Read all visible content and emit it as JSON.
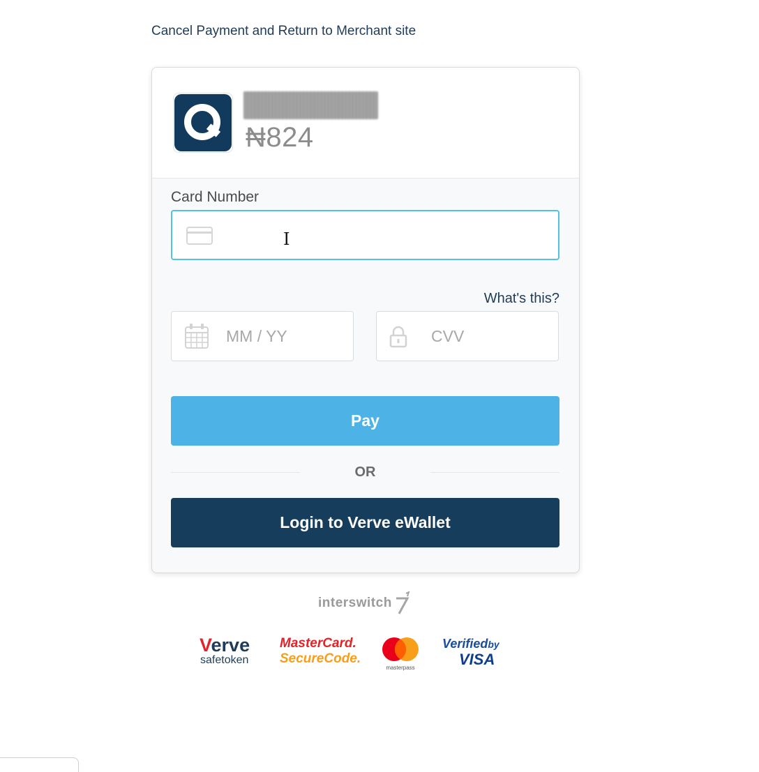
{
  "cancel_link": "Cancel Payment and Return to Merchant site",
  "merchant": {
    "logo_icon": "merchant-q-logo",
    "amount": "₦824"
  },
  "form": {
    "card_number_label": "Card Number",
    "card_number_value": "",
    "card_icon": "credit-card-icon",
    "whats_this": "What's this?",
    "expiry_placeholder": "MM / YY",
    "expiry_icon": "calendar-icon",
    "cvv_placeholder": "CVV",
    "cvv_icon": "lock-icon",
    "pay_button": "Pay",
    "or_divider": "OR",
    "ewallet_button": "Login to Verve eWallet"
  },
  "footer": {
    "provider": "Interswitch",
    "badges": {
      "verve_word_rest": "erve",
      "verve_word_first": "V",
      "verve_sub": "safetoken",
      "mastercard_line1": "MasterCard.",
      "mastercard_line2": "SecureCode.",
      "masterpass_text": "masterpass",
      "verified_line1": "Verified",
      "verified_by": "by",
      "verified_line2": "VISA"
    }
  },
  "colors": {
    "pay_button": "#4db3e6",
    "ewallet_button": "#163e5c",
    "focus_border": "#4fc3e0",
    "link": "#1f3b57"
  }
}
